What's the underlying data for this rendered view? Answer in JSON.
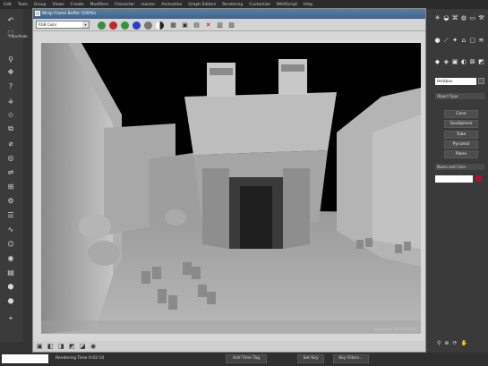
{
  "menubar": {
    "items": [
      "Edit",
      "Tools",
      "Group",
      "Views",
      "Create",
      "Modifiers",
      "Character",
      "reactor",
      "Animation",
      "Graph Editors",
      "Rendering",
      "Customize",
      "MAXScript",
      "Help"
    ]
  },
  "left_toolbar": {
    "label": "ClearAndo"
  },
  "render_window": {
    "title": "Wrap Frame Buffer (100%)",
    "channel_select": "RGB Color",
    "stats_text": "render time: 00: 2m 08.82"
  },
  "right_panel": {
    "name_field": "Hellsbox",
    "object_type_header": "Object Type",
    "buttons": [
      "Cone",
      "GeoSphere",
      "Tube",
      "Pyramid",
      "Plane"
    ],
    "name_color_header": "Name and Color",
    "name_color_field": "",
    "swatch_color": "#b01030"
  },
  "statusbar": {
    "left_field": "",
    "rendering_time": "Rendering Time  0:02:10",
    "add_time_tag": "Add Time Tag",
    "set_key": "Set Key",
    "key_filters": "Key Filters..."
  },
  "colors": {
    "title_bar": "#4a6f97",
    "panel_bg": "#3a3a3a",
    "accent_red": "#b01030"
  }
}
